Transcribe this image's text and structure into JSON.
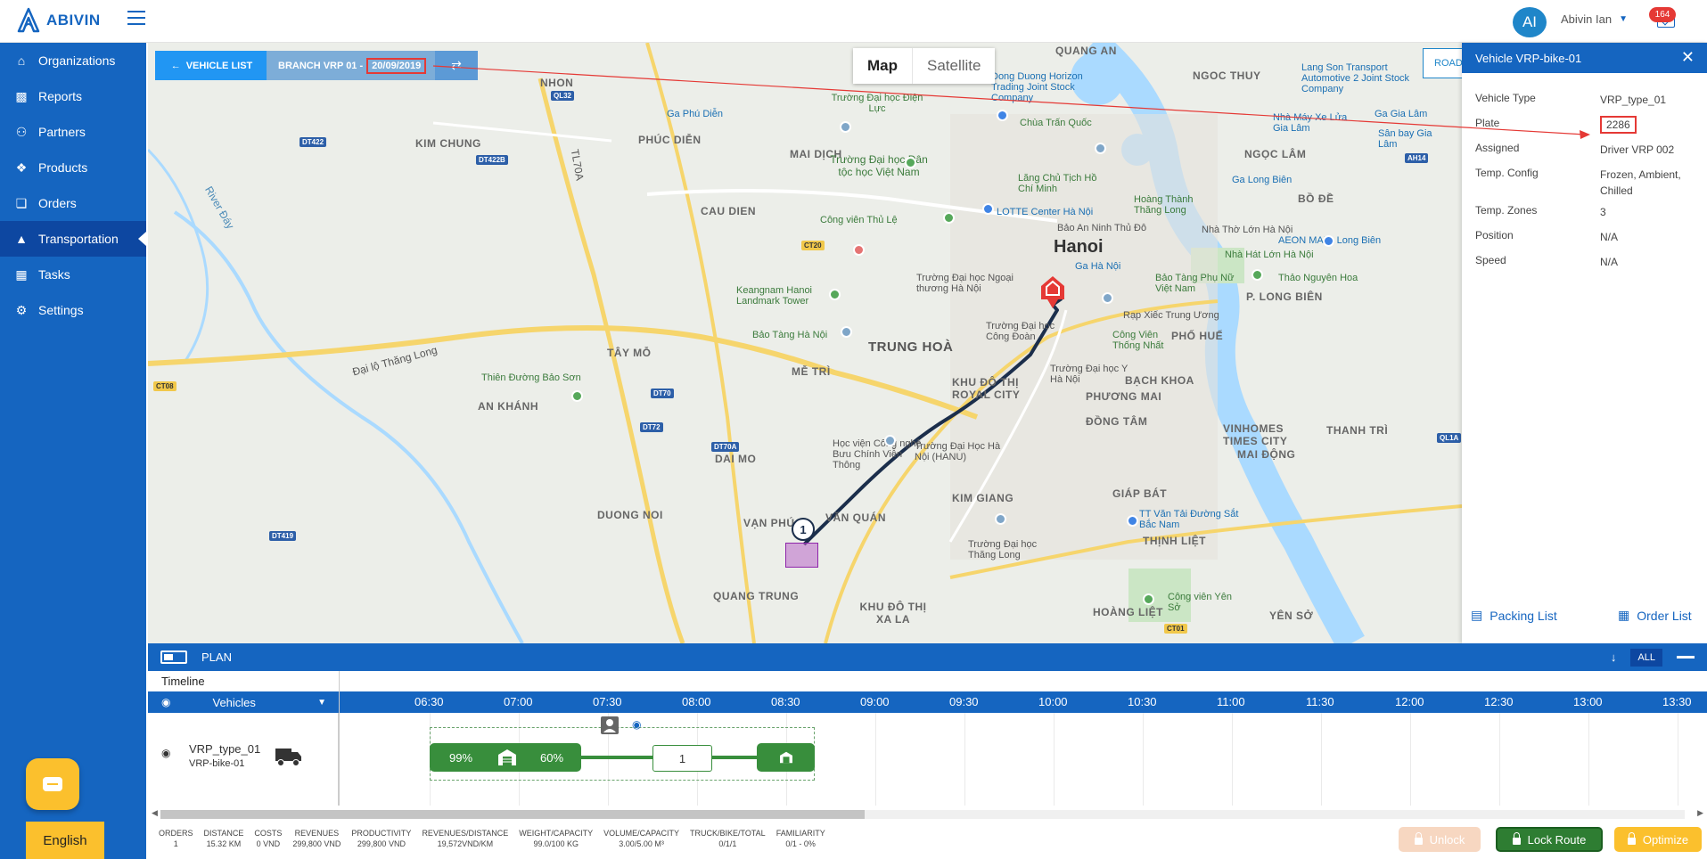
{
  "brand": {
    "name": "ABIVIN",
    "color": "#1565c0"
  },
  "user": {
    "initials": "AI",
    "name": "Abivin Ian",
    "notifications": "164"
  },
  "sidebar": {
    "items": [
      {
        "label": "Organizations",
        "icon": "home-icon"
      },
      {
        "label": "Reports",
        "icon": "bar-chart-icon"
      },
      {
        "label": "Partners",
        "icon": "users-icon"
      },
      {
        "label": "Products",
        "icon": "boxes-icon"
      },
      {
        "label": "Orders",
        "icon": "cubes-icon"
      },
      {
        "label": "Transportation",
        "icon": "road-icon",
        "active": true
      },
      {
        "label": "Tasks",
        "icon": "calendar-icon"
      },
      {
        "label": "Settings",
        "icon": "gear-icon"
      }
    ],
    "language": "English"
  },
  "map": {
    "vehicle_list_label": "VEHICLE LIST",
    "branch_label": "BRANCH VRP 01 -",
    "date": "20/09/2019",
    "map_type": {
      "map": "Map",
      "satellite": "Satellite"
    },
    "road_button": "ROAD",
    "city": "Hanoi",
    "stop_number": "1",
    "districts": [
      "NHON",
      "KIM CHUNG",
      "PHÚC DIỄN",
      "MAI DỊCH",
      "CAU DIEN",
      "TÂY MỖ",
      "MỄ TRÌ",
      "AN KHÁNH",
      "TRUNG HOÀ",
      "DAI MO",
      "DUONG NOI",
      "VẠN PHÚC",
      "VĂN QUÁN",
      "QUANG TRUNG",
      "KHU ĐÔ THỊ XA LA",
      "KIM GIANG",
      "GIÁP BÁT",
      "THỊNH LIỆT",
      "HOÀNG LIỆT",
      "YÊN SỞ",
      "PHƯƠNG MAI",
      "ĐỒNG TÂM",
      "MAI ĐỘNG",
      "BẠCH KHOA",
      "PHỐ HUẾ",
      "THANH TRÌ",
      "VINHOMES TIMES CITY",
      "QUANG AN",
      "NGOC THUY",
      "NGỌC LÂM",
      "BỒ ĐỀ",
      "P. LONG BIÊN",
      "KHU ĐÔ THỊ ROYAL CITY"
    ],
    "pois": [
      "Trường Đại học Điện Lực",
      "Ga Phú Diễn",
      "Trường Đại học Dân tộc học Việt Nam",
      "Công viên Thủ Lệ",
      "Keangnam Hanoi Landmark Tower",
      "Bảo Tàng Hà Nội",
      "Thiên Đường Bảo Sơn",
      "Chùa Trấn Quốc",
      "Lăng Chủ Tịch Hồ Chí Minh",
      "LOTTE Center Hà Nội",
      "Hoàng Thành Thăng Long",
      "Bảo Tàng Phụ Nữ Việt Nam",
      "Ga Hà Nội",
      "Nhà Hát Lớn Hà Nội",
      "AEON MALL Long Biên",
      "Thảo Nguyên Hoa",
      "Dong Duong Horizon Trading Joint Stock Company",
      "Lang Son Transport Automotive 2 Joint Stock Company",
      "Rạp Xiếc Trung Ương",
      "Công Viên Thống Nhất",
      "Trường Đại học Công Đoàn",
      "Trường Đại học Y Hà Nội",
      "Học viện Công nghệ Bưu Chính Viễn Thông",
      "Trường Đại Học Hà Nội (HANU)",
      "Trường Đại học Thăng Long",
      "TT Văn Tải Đường Sắt Bắc Nam",
      "Công viên Yên Sở",
      "Nhà Thờ Lớn Hà Nội",
      "Bảo An Ninh Thủ Đô",
      "Ga Long Biên",
      "Ga Gia Lâm",
      "Sân bay Gia Lâm",
      "Nhà Máy Xe Lửa Gia Lâm",
      "Trường Đại học Ngoại thương Hà Nội"
    ],
    "roads": [
      "Đại lộ Thăng Long",
      "TL70A",
      "River Đáy"
    ],
    "shields": [
      "QL32",
      "DT422",
      "DT422B",
      "CT20",
      "CT08",
      "DT70",
      "DT72",
      "DT70A",
      "DT419",
      "QL1A",
      "CT01",
      "AH14"
    ]
  },
  "vehicle_panel": {
    "title": "Vehicle VRP-bike-01",
    "rows": [
      {
        "key": "Vehicle Type",
        "value": "VRP_type_01"
      },
      {
        "key": "Plate",
        "value": "2286"
      },
      {
        "key": "Assigned",
        "value": "Driver VRP 002"
      },
      {
        "key": "Temp. Config",
        "value": "Frozen, Ambient, Chilled"
      },
      {
        "key": "Temp. Zones",
        "value": "3"
      },
      {
        "key": "Position",
        "value": "N/A"
      },
      {
        "key": "Speed",
        "value": "N/A"
      }
    ],
    "packing_list": "Packing List",
    "order_list": "Order List"
  },
  "plan": {
    "title": "PLAN",
    "all_label": "ALL",
    "timeline_label": "Timeline",
    "vehicles_label": "Vehicles",
    "times": [
      "06:30",
      "07:00",
      "07:30",
      "08:00",
      "08:30",
      "09:00",
      "09:30",
      "10:00",
      "10:30",
      "11:00",
      "11:30",
      "12:00",
      "12:30",
      "13:00",
      "13:30"
    ],
    "vehicle": {
      "type": "VRP_type_01",
      "name": "VRP-bike-01"
    },
    "route": {
      "load_start": "99%",
      "load_end": "60%",
      "order_count": "1"
    }
  },
  "stats": [
    {
      "key": "ORDERS",
      "value": "1"
    },
    {
      "key": "DISTANCE",
      "value": "15.32 KM"
    },
    {
      "key": "COSTS",
      "value": "0 VND"
    },
    {
      "key": "REVENUES",
      "value": "299,800 VND"
    },
    {
      "key": "PRODUCTIVITY",
      "value": "299,800 VND"
    },
    {
      "key": "REVENUES/DISTANCE",
      "value": "19,572VND/KM"
    },
    {
      "key": "WEIGHT/CAPACITY",
      "value": "99.0/100 KG"
    },
    {
      "key": "VOLUME/CAPACITY",
      "value": "3.00/5.00 M³"
    },
    {
      "key": "TRUCK/BIKE/TOTAL",
      "value": "0/1/1"
    },
    {
      "key": "FAMILIARITY",
      "value": "0/1 - 0%"
    }
  ],
  "actions": {
    "unlock": "Unlock",
    "lock_route": "Lock Route",
    "optimize": "Optimize"
  },
  "colors": {
    "primary": "#1565c0",
    "route": "#1b2e4b",
    "green": "#388e3c",
    "yellow": "#fbc02d",
    "annotation": "#e53935"
  }
}
